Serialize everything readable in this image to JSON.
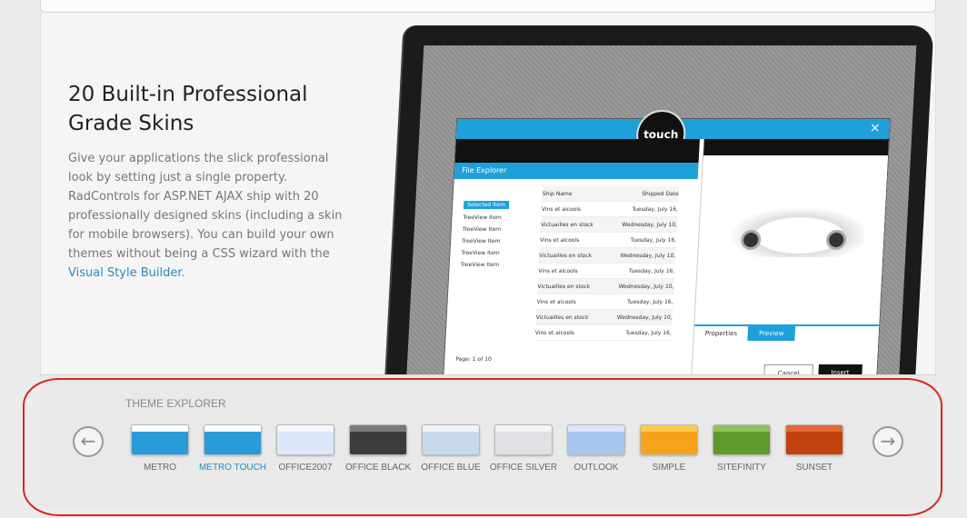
{
  "hero": {
    "title": "20 Built-in Professional Grade Skins",
    "description_prefix": "Give your applications the slick professional look by setting just a single property. RadControls for ASP.NET AJAX ship with 20 professionally designed skins (including a skin for mobile browsers). You can build your own themes without being a CSS wizard with the ",
    "link_text": "Visual Style Builder",
    "description_suffix": "."
  },
  "screenshot": {
    "badge": "touch",
    "close_glyph": "×",
    "file_explorer_title": "File Explorer",
    "tree_items": [
      "Selected Item",
      "TreeView Item",
      "TreeView Item",
      "TreeView Item",
      "TreeView Item",
      "TreeView Item"
    ],
    "grid_header": [
      "Ship Name",
      "Shipped Date"
    ],
    "grid_rows": [
      [
        "Vins et alcools",
        "Tuesday, July 16,"
      ],
      [
        "Victuailles en stock",
        "Wednesday, July 10,"
      ],
      [
        "Vins et alcools",
        "Tuesday, July 16,"
      ],
      [
        "Victuailles en stock",
        "Wednesday, July 10,"
      ],
      [
        "Vins et alcools",
        "Tuesday, July 16,"
      ],
      [
        "Victuailles en stock",
        "Wednesday, July 10,"
      ],
      [
        "Vins et alcools",
        "Tuesday, July 16,"
      ],
      [
        "Victuailles en stock",
        "Wednesday, July 10,"
      ],
      [
        "Vins et alcools",
        "Tuesday, July 16,"
      ]
    ],
    "pager_label": "Page:",
    "pager_value": "1",
    "pager_total": "of 10",
    "tabs": [
      "Properties",
      "Preview"
    ],
    "cancel_label": "Cancel",
    "insert_label": "Insert"
  },
  "theme_explorer": {
    "label": "THEME EXPLORER",
    "prev_glyph": "←",
    "next_glyph": "→",
    "skins": [
      {
        "name": "METRO",
        "color": "#2a9bd8",
        "top": "#ffffff",
        "selected": false
      },
      {
        "name": "METRO TOUCH",
        "color": "#2a9bd8",
        "top": "#ffffff",
        "selected": true
      },
      {
        "name": "OFFICE2007",
        "color": "#dce8f7",
        "top": "#f3f7fd",
        "selected": false
      },
      {
        "name": "OFFICE BLACK",
        "color": "#3c3c3c",
        "top": "#7a7a7a",
        "selected": false
      },
      {
        "name": "OFFICE BLUE",
        "color": "#c9d8ec",
        "top": "#eef3fa",
        "selected": false
      },
      {
        "name": "OFFICE SILVER",
        "color": "#dfe1e5",
        "top": "#f4f5f7",
        "selected": false
      },
      {
        "name": "OUTLOOK",
        "color": "#a9c6ee",
        "top": "#dae6f8",
        "selected": false
      },
      {
        "name": "SIMPLE",
        "color": "#f6a21a",
        "top": "#ffcb4a",
        "selected": false
      },
      {
        "name": "SITEFINITY",
        "color": "#5d9a2e",
        "top": "#8ec25c",
        "selected": false
      },
      {
        "name": "SUNSET",
        "color": "#c2410f",
        "top": "#e36a37",
        "selected": false
      }
    ]
  }
}
